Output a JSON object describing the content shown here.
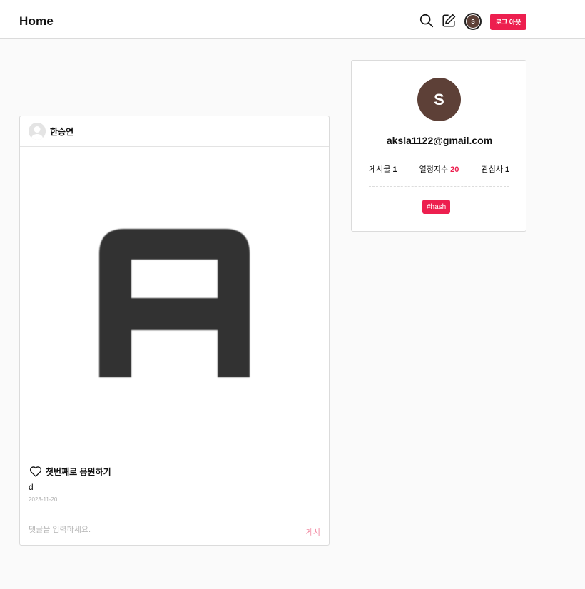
{
  "header": {
    "title": "Home",
    "search_icon": "search-icon",
    "write_icon": "edit-icon",
    "avatar_letter": "S",
    "logout_label": "로그 아웃"
  },
  "post": {
    "author": "한승연",
    "like_text": "첫번째로 응원하기",
    "caption": "d",
    "date": "2023-11-20",
    "comment_placeholder": "댓글을 입력하세요.",
    "submit_label": "게시"
  },
  "profile": {
    "avatar_letter": "S",
    "email": "aksla1122@gmail.com",
    "stats": [
      {
        "label": "게시물",
        "value": "1"
      },
      {
        "label": "열정지수",
        "value": "20"
      },
      {
        "label": "관심사",
        "value": "1"
      }
    ],
    "tag": "#hash"
  },
  "colors": {
    "accent": "#ed1f4f",
    "avatar_bg": "#5d4037"
  }
}
